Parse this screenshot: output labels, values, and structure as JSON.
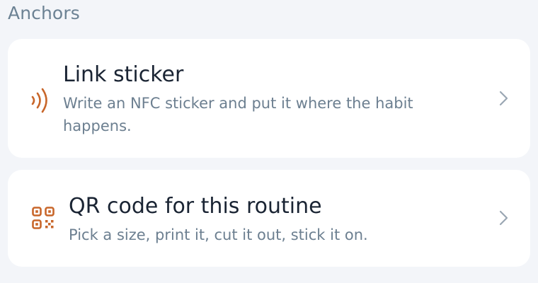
{
  "section": {
    "title": "Anchors"
  },
  "cards": [
    {
      "title": "Link sticker",
      "subtitle": "Write an NFC sticker and put it where the habit happens.",
      "icon": "nfc-icon"
    },
    {
      "title": "QR code for this routine",
      "subtitle": "Pick a size, print it, cut it out, stick it on.",
      "icon": "qr-code-icon"
    }
  ],
  "colors": {
    "background": "#f3f5f9",
    "card": "#ffffff",
    "accent": "#c8662a",
    "title": "#1a2433",
    "subtitle": "#6c7f90",
    "section_header": "#6c8294",
    "chevron": "#9aa7b3"
  }
}
